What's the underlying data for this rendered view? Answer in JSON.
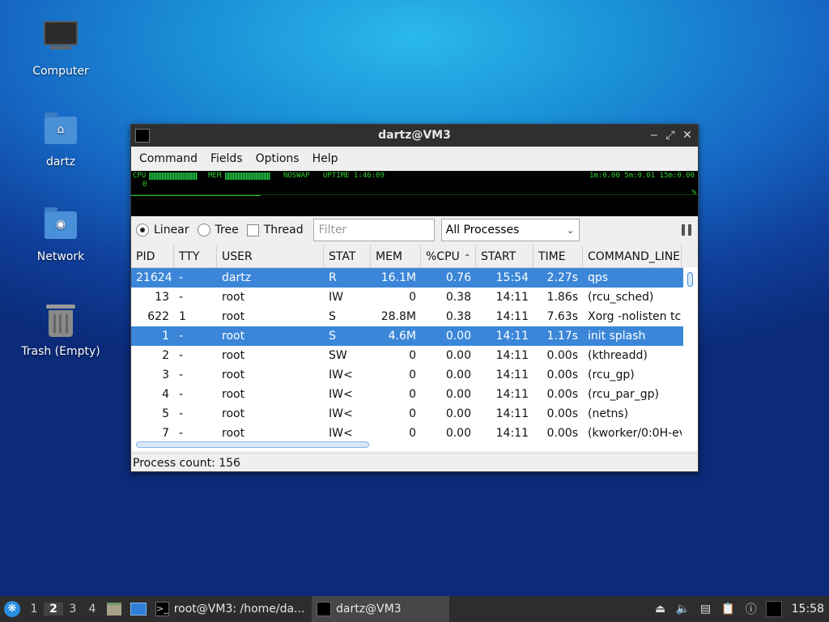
{
  "desktop": {
    "icons": [
      {
        "label": "Computer",
        "icon": "computer-icon"
      },
      {
        "label": "dartz",
        "icon": "home-folder-icon"
      },
      {
        "label": "Network",
        "icon": "network-folder-icon"
      },
      {
        "label": "Trash (Empty)",
        "icon": "trash-icon"
      }
    ]
  },
  "window": {
    "title": "dartz@VM3",
    "controls": {
      "minimize": "‒",
      "maximize": "⤢",
      "close": "✕"
    },
    "menu": [
      "Command",
      "Fields",
      "Options",
      "Help"
    ],
    "graph": {
      "cpu_label": "CPU",
      "mem_label": "MEM",
      "swap_label": "NOSWAP",
      "uptime_label": "UPTIME 1:46:09",
      "load_label": "1m:0.00 5m:0.01 15m:0.00",
      "cpu_value": "0",
      "pct_marker": "%"
    },
    "toolbar": {
      "linear": "Linear",
      "tree": "Tree",
      "thread": "Thread",
      "view_mode": "Linear",
      "thread_checked": false,
      "filter_placeholder": "Filter",
      "process_filter": "All Processes"
    },
    "columns": [
      "PID",
      "TTY",
      "USER",
      "STAT",
      "MEM",
      "%CPU",
      "START",
      "TIME",
      "COMMAND_LINE"
    ],
    "sort_indicator": "^",
    "rows": [
      {
        "pid": "21624",
        "tty": "-",
        "user": "dartz",
        "stat": "R",
        "mem": "16.1M",
        "cpu": "0.76",
        "start": "15:54",
        "time": "2.27s",
        "cmd": "qps",
        "selected": true
      },
      {
        "pid": "13",
        "tty": "-",
        "user": "root",
        "stat": "IW",
        "mem": "0",
        "cpu": "0.38",
        "start": "14:11",
        "time": "1.86s",
        "cmd": "(rcu_sched)",
        "selected": false
      },
      {
        "pid": "622",
        "tty": "1",
        "user": "root",
        "stat": "S",
        "mem": "28.8M",
        "cpu": "0.38",
        "start": "14:11",
        "time": "7.63s",
        "cmd": "Xorg -nolisten tcp",
        "selected": false
      },
      {
        "pid": "1",
        "tty": "-",
        "user": "root",
        "stat": "S",
        "mem": "4.6M",
        "cpu": "0.00",
        "start": "14:11",
        "time": "1.17s",
        "cmd": "init splash",
        "selected": true
      },
      {
        "pid": "2",
        "tty": "-",
        "user": "root",
        "stat": "SW",
        "mem": "0",
        "cpu": "0.00",
        "start": "14:11",
        "time": "0.00s",
        "cmd": "(kthreadd)",
        "selected": false
      },
      {
        "pid": "3",
        "tty": "-",
        "user": "root",
        "stat": "IW<",
        "mem": "0",
        "cpu": "0.00",
        "start": "14:11",
        "time": "0.00s",
        "cmd": "(rcu_gp)",
        "selected": false
      },
      {
        "pid": "4",
        "tty": "-",
        "user": "root",
        "stat": "IW<",
        "mem": "0",
        "cpu": "0.00",
        "start": "14:11",
        "time": "0.00s",
        "cmd": "(rcu_par_gp)",
        "selected": false
      },
      {
        "pid": "5",
        "tty": "-",
        "user": "root",
        "stat": "IW<",
        "mem": "0",
        "cpu": "0.00",
        "start": "14:11",
        "time": "0.00s",
        "cmd": "(netns)",
        "selected": false
      },
      {
        "pid": "7",
        "tty": "-",
        "user": "root",
        "stat": "IW<",
        "mem": "0",
        "cpu": "0.00",
        "start": "14:11",
        "time": "0.00s",
        "cmd": "(kworker/0:0H-ev",
        "selected": false
      }
    ],
    "status": "Process count: 156"
  },
  "taskbar": {
    "workspaces": [
      "1",
      "2",
      "3",
      "4"
    ],
    "active_workspace": "2",
    "tasks": [
      {
        "label": "root@VM3: /home/da...",
        "icon": "terminal-icon",
        "glyph": ">_",
        "active": false
      },
      {
        "label": "dartz@VM3",
        "icon": "qps-icon",
        "glyph": "",
        "active": true
      }
    ],
    "clock": "15:58"
  },
  "colors": {
    "selection": "#3b86d8",
    "titlebar": "#2f2f2f",
    "taskbar": "#2d2d2d",
    "graph_green": "#2fcf2f"
  }
}
